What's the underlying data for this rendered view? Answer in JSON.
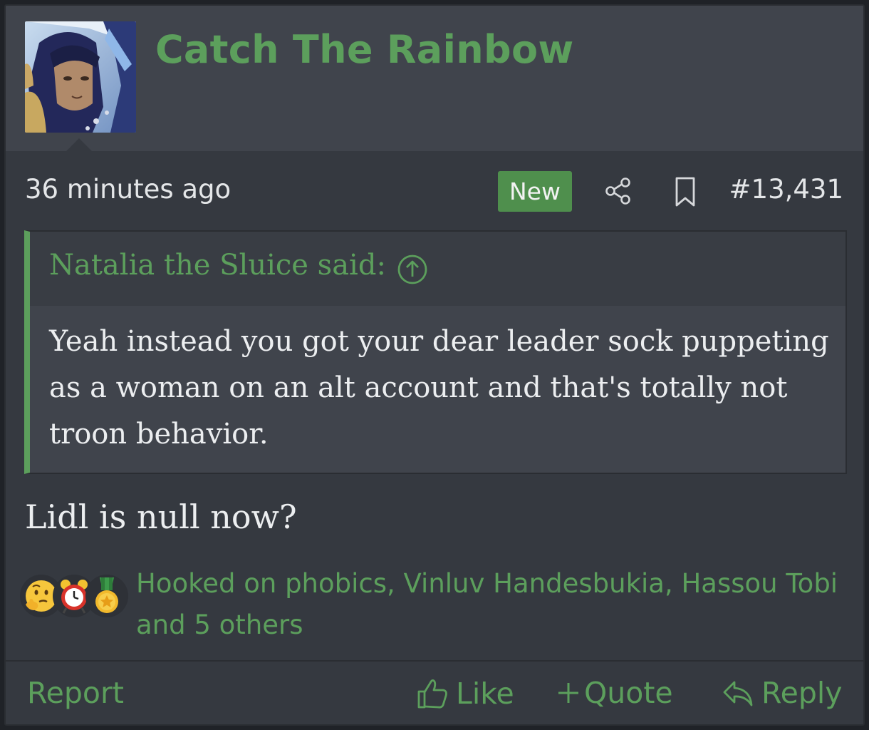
{
  "post": {
    "username": "Catch The Rainbow",
    "timestamp": "36 minutes ago",
    "new_badge": "New",
    "post_number": "#13,431",
    "quote": {
      "author": "Natalia the Sluice said:",
      "text": "Yeah instead you got your dear leader sock puppeting as a woman on an alt account and that's totally not troon behavior."
    },
    "text": "Lidl is null now?",
    "reactions": {
      "icons": [
        "thinking-face-icon",
        "alarm-clock-icon",
        "medal-icon"
      ],
      "users_text": "Hooked on phobics, Vinluv Handesbukia, Hassou Tobi and 5 others"
    },
    "actions": {
      "report": "Report",
      "like": "Like",
      "quote": "Quote",
      "reply": "Reply"
    }
  },
  "colors": {
    "accent": "#5c9f5c",
    "badge": "#4f8f4d",
    "background": "#353940",
    "header": "#40444c",
    "text": "#eceef0"
  }
}
